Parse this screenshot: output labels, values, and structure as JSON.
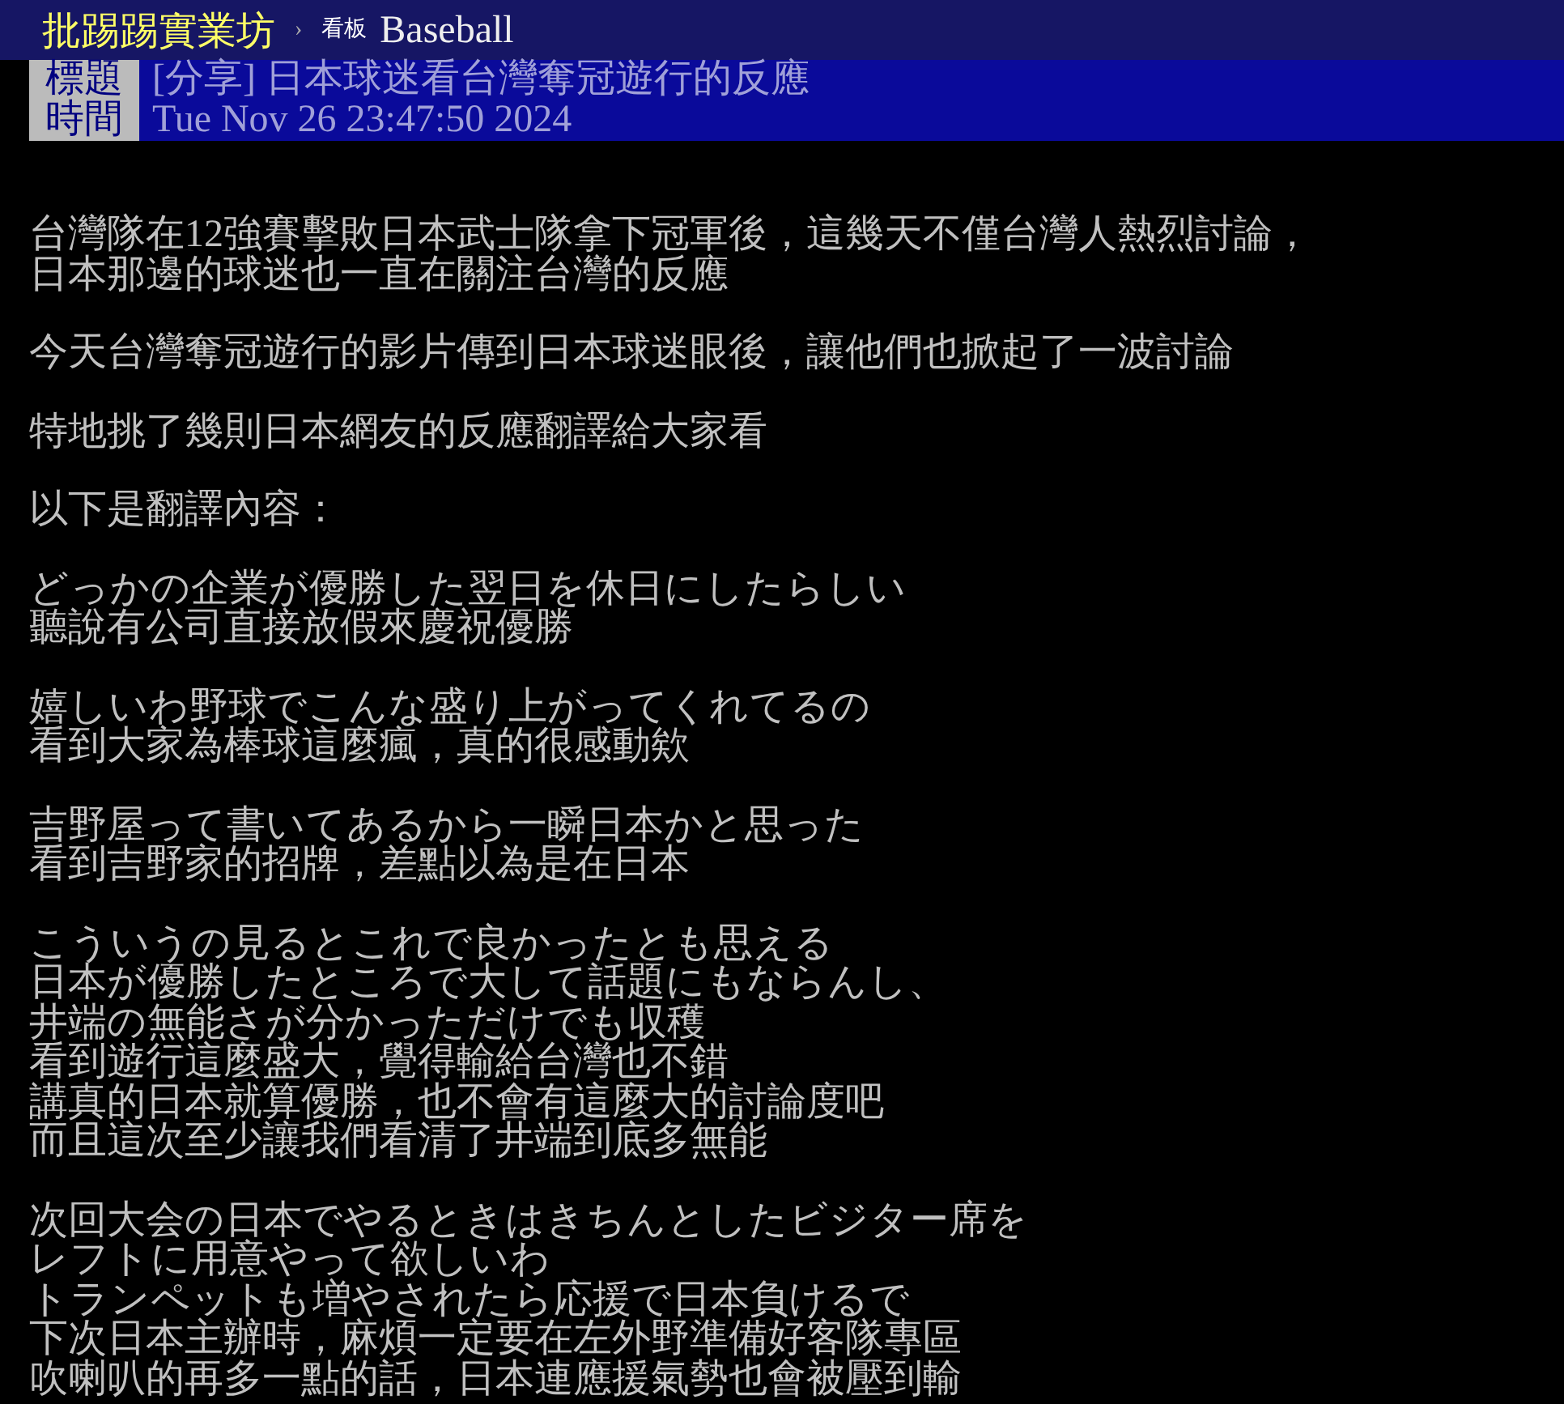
{
  "topbar": {
    "site": "批踢踢實業坊",
    "separator": "›",
    "board_label": "看板",
    "board": "Baseball"
  },
  "meta": [
    {
      "label": "標題",
      "value": "[分享] 日本球迷看台灣奪冠遊行的反應"
    },
    {
      "label": "時間",
      "value": "Tue Nov 26 23:47:50 2024"
    }
  ],
  "paragraphs": [
    [
      "台灣隊在12強賽擊敗日本武士隊拿下冠軍後，這幾天不僅台灣人熱烈討論，",
      "日本那邊的球迷也一直在關注台灣的反應"
    ],
    [
      "今天台灣奪冠遊行的影片傳到日本球迷眼後，讓他們也掀起了一波討論"
    ],
    [
      "特地挑了幾則日本網友的反應翻譯給大家看"
    ],
    [
      "以下是翻譯內容："
    ],
    [
      "どっかの企業が優勝した翌日を休日にしたらしい",
      "聽說有公司直接放假來慶祝優勝"
    ],
    [
      "嬉しいわ野球でこんな盛り上がってくれてるの",
      "看到大家為棒球這麼瘋，真的很感動欸"
    ],
    [
      "吉野屋って書いてあるから一瞬日本かと思った",
      "看到吉野家的招牌，差點以為是在日本"
    ],
    [
      "こういうの見るとこれで良かったとも思える",
      "日本が優勝したところで大して話題にもならんし、",
      "井端の無能さが分かっただけでも収穫",
      "看到遊行這麼盛大，覺得輸給台灣也不錯",
      "講真的日本就算優勝，也不會有這麼大的討論度吧",
      "而且這次至少讓我們看清了井端到底多無能"
    ],
    [
      "次回大会の日本でやるときはきちんとしたビジター席を",
      "レフトに用意やって欲しいわ",
      "トランペットも増やされたら応援で日本負けるで",
      "下次日本主辦時，麻煩一定要在左外野準備好客隊專區",
      "吹喇叭的再多一點的話，日本連應援氣勢也會被壓到輸"
    ]
  ]
}
